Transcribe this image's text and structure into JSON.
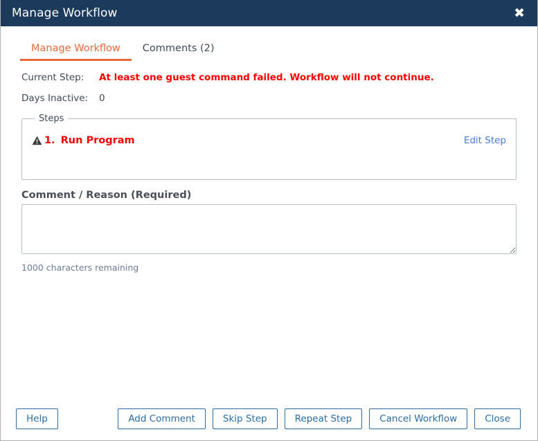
{
  "window": {
    "title": "Manage Workflow",
    "close_icon": "close-icon",
    "close_glyph": "✖"
  },
  "tabs": [
    {
      "label": "Manage Workflow",
      "active": true
    },
    {
      "label": "Comments (2)",
      "active": false
    }
  ],
  "details": {
    "current_step_label": "Current Step:",
    "current_step_value": "At least one guest command failed. Workflow will not continue.",
    "days_inactive_label": "Days Inactive:",
    "days_inactive_value": "0"
  },
  "steps": {
    "legend": "Steps",
    "items": [
      {
        "icon": "warning-triangle-icon",
        "number": "1.",
        "name": "Run Program",
        "action_label": "Edit Step"
      }
    ]
  },
  "comment": {
    "label": "Comment / Reason (Required)",
    "value": "",
    "placeholder": "",
    "chars_remaining": "1000 characters remaining"
  },
  "footer": {
    "help_label": "Help",
    "buttons": [
      {
        "label": "Add Comment"
      },
      {
        "label": "Skip Step"
      },
      {
        "label": "Repeat Step"
      },
      {
        "label": "Cancel Workflow"
      },
      {
        "label": "Close"
      }
    ]
  },
  "colors": {
    "titlebar": "#1c3a5c",
    "accent_tab": "#e8683a",
    "error": "#ff0000",
    "link": "#4a7ad8",
    "button_border": "#2b6ca3",
    "muted_text": "#6b7d93"
  }
}
